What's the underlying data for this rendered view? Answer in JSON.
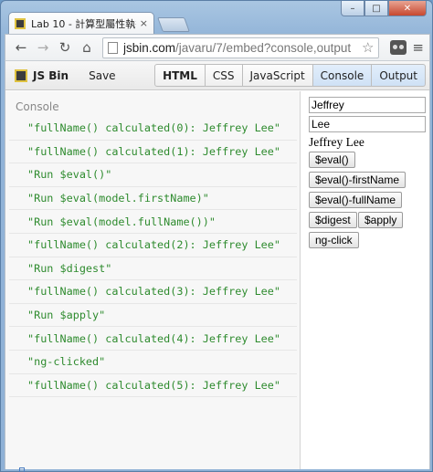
{
  "browser": {
    "tab_title": "Lab 10 - 計算型屬性執行步",
    "tab_close": "×",
    "url_host": "jsbin.com",
    "url_path": "/javaru/7/embed?console,output",
    "controls": {
      "minimize": "–",
      "maximize": "□",
      "close": "✕"
    },
    "icons": {
      "back": "back-arrow-icon",
      "forward": "forward-arrow-icon",
      "reload": "reload-icon",
      "home": "home-icon",
      "star": "star-icon",
      "menu": "menu-icon"
    }
  },
  "jsbin": {
    "brand": "JS Bin",
    "save_label": "Save",
    "panels": [
      "HTML",
      "CSS",
      "JavaScript",
      "Console",
      "Output"
    ]
  },
  "console": {
    "label": "Console",
    "logs": [
      "\"fullName() calculated(0): Jeffrey Lee\"",
      "\"fullName() calculated(1): Jeffrey Lee\"",
      "\"Run $eval()\"",
      "\"Run $eval(model.firstName)\"",
      "\"Run $eval(model.fullName())\"",
      "\"fullName() calculated(2): Jeffrey Lee\"",
      "\"Run $digest\"",
      "\"fullName() calculated(3): Jeffrey Lee\"",
      "\"Run $apply\"",
      "\"fullName() calculated(4): Jeffrey Lee\"",
      "\"ng-clicked\"",
      "\"fullName() calculated(5): Jeffrey Lee\""
    ]
  },
  "output": {
    "first_name": "Jeffrey",
    "last_name": "Lee",
    "full_name": "Jeffrey Lee",
    "buttons": {
      "eval": "$eval()",
      "eval_first": "$eval()-firstName",
      "eval_full": "$eval()-fullName",
      "digest": "$digest",
      "apply": "$apply",
      "ngclick": "ng-click"
    }
  },
  "colors": {
    "console_text": "#2e8b2e",
    "active_panel": "#cfe1f5"
  }
}
